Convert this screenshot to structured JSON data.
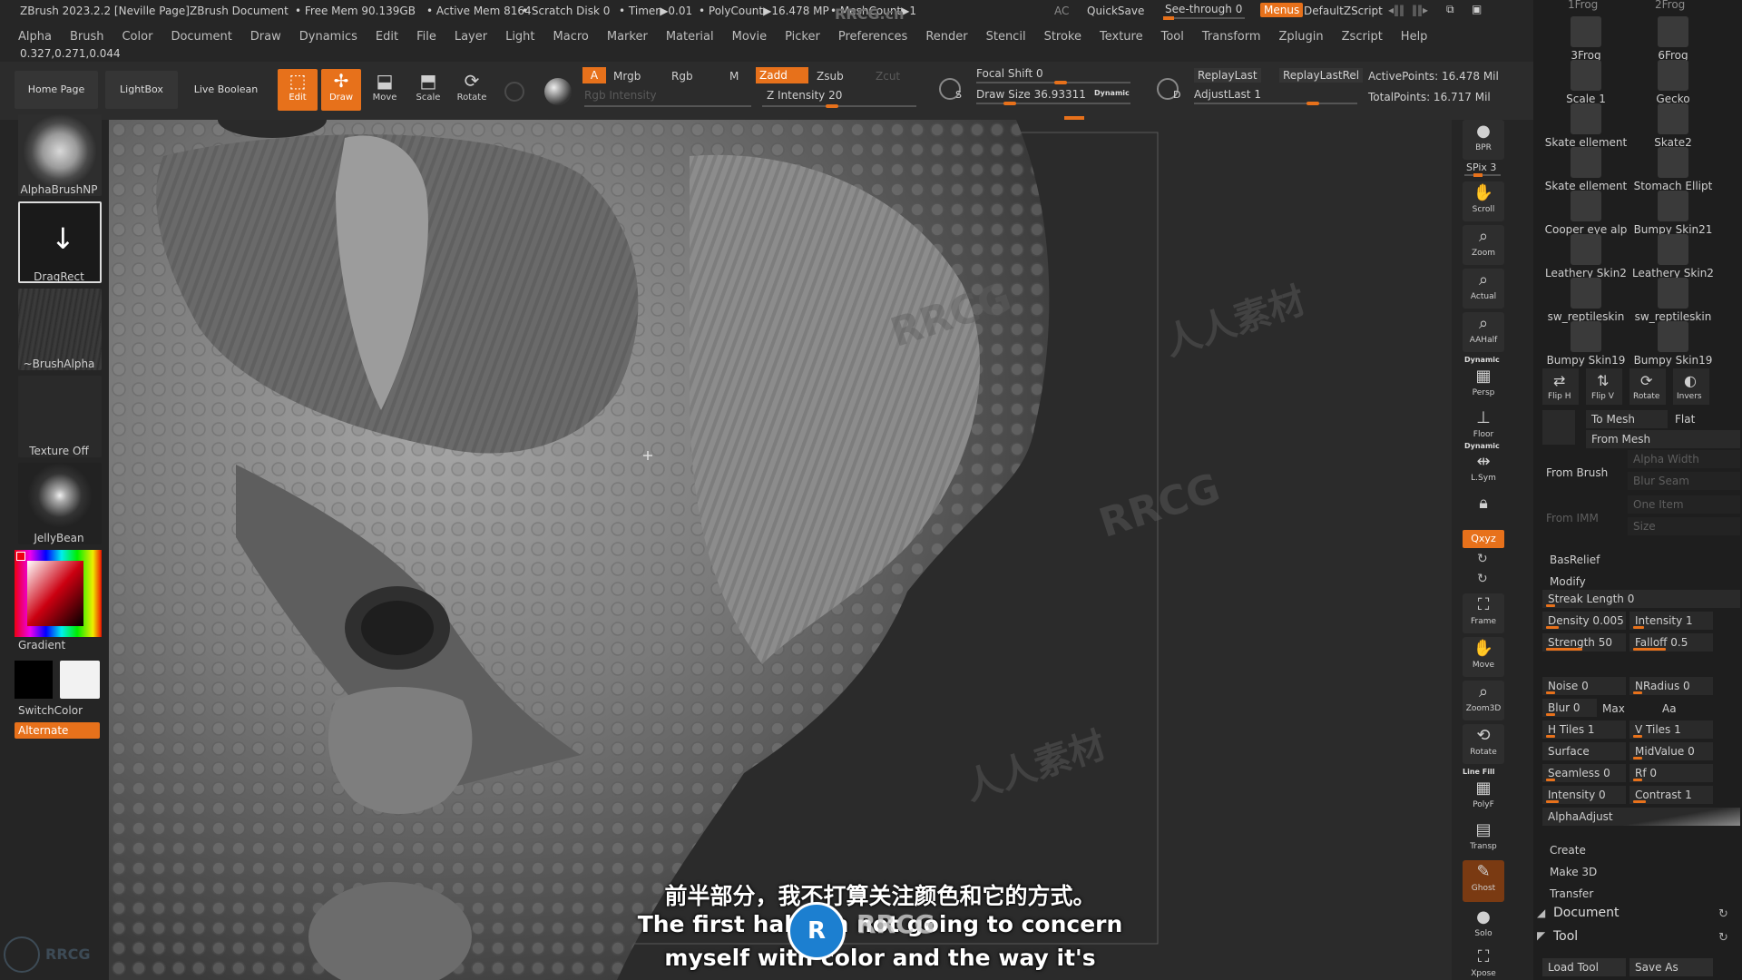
{
  "titlebar": {
    "app_title": "ZBrush 2023.2.2 [Neville Page]ZBrush Document",
    "free_mem": "• Free Mem 90.139GB",
    "active_mem": "• Active Mem 8164",
    "scratch_disk": "• Scratch Disk 0",
    "timer": "• Timer▶0.01",
    "poly_count": "• PolyCount▶16.478 MP",
    "mesh_count": "• MeshCount▶1",
    "ac": "AC",
    "quicksave": "QuickSave",
    "see_through": "See-through",
    "see_through_value": "0",
    "menus": "Menus",
    "default_zscript": "DefaultZScript"
  },
  "menubar": {
    "items": [
      "Alpha",
      "Brush",
      "Color",
      "Document",
      "Draw",
      "Dynamics",
      "Edit",
      "File",
      "Layer",
      "Light",
      "Macro",
      "Marker",
      "Material",
      "Movie",
      "Picker",
      "Preferences",
      "Render",
      "Stencil",
      "Stroke",
      "Texture",
      "Tool",
      "Transform",
      "Zplugin",
      "Zscript",
      "Help"
    ]
  },
  "coords": "0.327,0.271,0.044",
  "toolbar": {
    "home_page": "Home Page",
    "lightbox": "LightBox",
    "live_boolean": "Live Boolean",
    "edit": "Edit",
    "draw": "Draw",
    "move": "Move",
    "scale": "Scale",
    "rotate": "Rotate",
    "a": "A",
    "mrgb": "Mrgb",
    "rgb": "Rgb",
    "m": "M",
    "zadd": "Zadd",
    "zsub": "Zsub",
    "zcut": "Zcut",
    "rgb_intensity": "Rgb Intensity",
    "z_intensity": "Z Intensity 20",
    "focal_shift": "Focal Shift 0",
    "draw_size": "Draw Size 36.93311",
    "dynamic": "Dynamic",
    "replay_last": "ReplayLast",
    "replay_last_rel": "ReplayLastRel",
    "adjust_last": "AdjustLast 1",
    "active_points": "ActivePoints: 16.478 Mil",
    "total_points": "TotalPoints: 16.717 Mil",
    "s_label": "S",
    "d_label": "D"
  },
  "leftshelf": {
    "alpha_brush": "AlphaBrushNP",
    "drag_rect": "DragRect",
    "brush_alpha": "~BrushAlpha",
    "texture_off": "Texture Off",
    "jellybean": "JellyBean",
    "gradient": "Gradient",
    "switch_color": "SwitchColor",
    "alternate": "Alternate"
  },
  "rightshelf": {
    "bpr": "BPR",
    "spix": "SPix 3",
    "scroll": "Scroll",
    "zoom": "Zoom",
    "actual": "Actual",
    "aahalf": "AAHalf",
    "dynamic": "Dynamic",
    "persp": "Persp",
    "floor": "Floor",
    "dynamic2": "Dynamic",
    "lsym": "L.Sym",
    "xyz": "Qxyz",
    "frame": "Frame",
    "move": "Move",
    "zoom3d": "Zoom3D",
    "rotate": "Rotate",
    "linefill": "Line Fill",
    "polyf": "PolyF",
    "transp": "Transp",
    "ghost": "Ghost",
    "solo": "Solo",
    "xpose": "Xpose"
  },
  "palette": {
    "top_items": [
      {
        "label": "3Frog"
      },
      {
        "label": "6Frog"
      },
      {
        "label": "Scale 1"
      },
      {
        "label": "Gecko"
      },
      {
        "label": "Skate ellement"
      },
      {
        "label": "Skate2"
      },
      {
        "label": "Skate ellement"
      },
      {
        "label": "Stomach Ellipt"
      },
      {
        "label": "Cooper eye alp"
      },
      {
        "label": "Bumpy Skin21"
      },
      {
        "label": "Leathery Skin2"
      },
      {
        "label": "Leathery Skin2"
      },
      {
        "label": "sw_reptileskin"
      },
      {
        "label": "sw_reptileskin"
      },
      {
        "label": "Bumpy Skin19"
      },
      {
        "label": "Bumpy Skin19"
      }
    ],
    "header_top_left": "1Frog",
    "header_top_right": "2Frog",
    "flip_h": "Flip H",
    "flip_v": "Flip V",
    "rotate": "Rotate",
    "invers": "Invers",
    "to_mesh": "To Mesh",
    "flat": "Flat",
    "from_mesh": "From Mesh",
    "from_brush": "From Brush",
    "alpha_width": "Alpha Width",
    "blur_seam": "Blur Seam",
    "from_imm": "From IMM",
    "one_item": "One Item",
    "size": "Size",
    "basrelief": "BasRelief",
    "modify": "Modify",
    "streak_length": "Streak Length 0",
    "density": "Density 0.005",
    "intensity": "Intensity 1",
    "strength": "Strength 50",
    "falloff": "Falloff 0.5",
    "noise": "Noise 0",
    "nradius": "NRadius 0",
    "blur": "Blur 0",
    "max": "Max",
    "aa": "Aa",
    "h_tiles": "H Tiles 1",
    "v_tiles": "V Tiles 1",
    "surface": "Surface",
    "midvalue": "MidValue 0",
    "seamless": "Seamless 0",
    "rf": "Rf 0",
    "intensity2": "Intensity 0",
    "contrast": "Contrast 1",
    "alpha_adjust": "AlphaAdjust",
    "create": "Create",
    "make_3d": "Make 3D",
    "transfer": "Transfer",
    "document": "Document",
    "tool": "Tool",
    "load_tool": "Load Tool",
    "save_as": "Save As"
  },
  "subtitles": {
    "chinese": "前半部分，我不打算关注颜色和它的方式。",
    "english_line1": "The first half I'm not going to concern",
    "english_line2": "myself with color and the way it's"
  },
  "watermarks": {
    "rrcg": "RRCG",
    "rrcg_cn": "RRCG.cn",
    "cn": "人人素材"
  },
  "colors": {
    "accent": "#e7711b",
    "background": "#1f1f1f",
    "canvas": "#2b2b2b"
  }
}
